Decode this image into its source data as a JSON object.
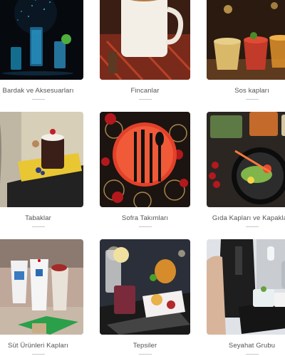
{
  "categories": [
    {
      "label": "Bardak ve Aksesuarları",
      "icon": "glasses-photo"
    },
    {
      "label": "Fincanlar",
      "icon": "coffee-cup-photo"
    },
    {
      "label": "Sos kapları",
      "icon": "sauce-cups-photo"
    },
    {
      "label": "Tabaklar",
      "icon": "cake-plate-photo"
    },
    {
      "label": "Sofra Takımları",
      "icon": "cutlery-set-photo"
    },
    {
      "label": "Gıda Kapları ve Kapakları",
      "icon": "food-container-photo"
    },
    {
      "label": "Süt Ürünleri Kapları",
      "icon": "dairy-cups-photo"
    },
    {
      "label": "Tepsiler",
      "icon": "tray-photo"
    },
    {
      "label": "Seyahat Grubu",
      "icon": "travel-service-photo"
    }
  ]
}
